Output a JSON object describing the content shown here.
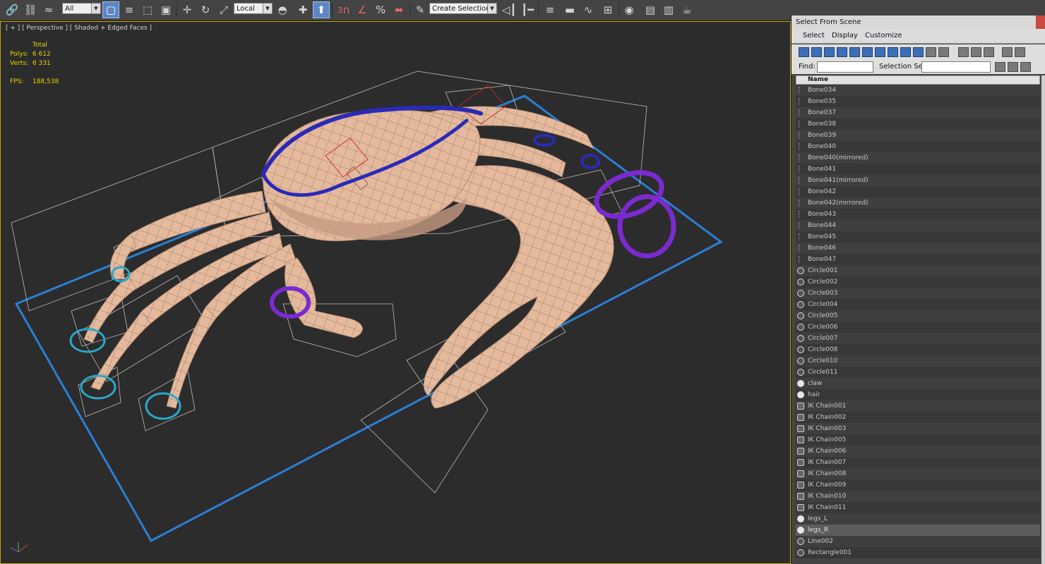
{
  "toolbar": {
    "selection_filter": "All",
    "coord_system": "Local",
    "named_selection_placeholder": "Create Selection Se",
    "snap_3d": "3",
    "percent_snap": "%"
  },
  "viewport": {
    "label": "[ + ] [ Perspective ] [ Shaded + Edged Faces ]",
    "stats": {
      "total_label": "Total",
      "polys_label": "Polys:",
      "polys_value": "6 612",
      "verts_label": "Verts:",
      "verts_value": "6 331",
      "fps_label": "FPS:",
      "fps_value": "188,538"
    }
  },
  "dialog": {
    "title": "Select From Scene",
    "menu": [
      "Select",
      "Display",
      "Customize"
    ],
    "find_label": "Find:",
    "selection_set_label": "Selection Set:",
    "column_name": "Name",
    "items": [
      {
        "name": "Bone034",
        "icon": "bone-icon"
      },
      {
        "name": "Bone035",
        "icon": "bone-icon"
      },
      {
        "name": "Bone037",
        "icon": "bone-icon"
      },
      {
        "name": "Bone038",
        "icon": "bone-icon"
      },
      {
        "name": "Bone039",
        "icon": "bone-icon"
      },
      {
        "name": "Bone040",
        "icon": "bone-icon"
      },
      {
        "name": "Bone040(mirrored)",
        "icon": "bone-icon"
      },
      {
        "name": "Bone041",
        "icon": "bone-icon"
      },
      {
        "name": "Bone041(mirrored)",
        "icon": "bone-icon"
      },
      {
        "name": "Bone042",
        "icon": "bone-icon"
      },
      {
        "name": "Bone042(mirrored)",
        "icon": "bone-icon"
      },
      {
        "name": "Bone043",
        "icon": "bone-icon"
      },
      {
        "name": "Bone044",
        "icon": "bone-icon"
      },
      {
        "name": "Bone045",
        "icon": "bone-icon"
      },
      {
        "name": "Bone046",
        "icon": "bone-icon"
      },
      {
        "name": "Bone047",
        "icon": "bone-icon"
      },
      {
        "name": "Circle001",
        "icon": "shape-icon"
      },
      {
        "name": "Circle002",
        "icon": "shape-icon"
      },
      {
        "name": "Circle003",
        "icon": "shape-icon"
      },
      {
        "name": "Circle004",
        "icon": "shape-icon"
      },
      {
        "name": "Circle005",
        "icon": "shape-icon"
      },
      {
        "name": "Circle006",
        "icon": "shape-icon"
      },
      {
        "name": "Circle007",
        "icon": "shape-icon"
      },
      {
        "name": "Circle008",
        "icon": "shape-icon"
      },
      {
        "name": "Circle010",
        "icon": "shape-icon"
      },
      {
        "name": "Circle011",
        "icon": "shape-icon"
      },
      {
        "name": "claw",
        "icon": "geometry-icon"
      },
      {
        "name": "hair",
        "icon": "geometry-icon"
      },
      {
        "name": "IK Chain001",
        "icon": "ik-chain-icon"
      },
      {
        "name": "IK Chain002",
        "icon": "ik-chain-icon"
      },
      {
        "name": "IK Chain003",
        "icon": "ik-chain-icon"
      },
      {
        "name": "IK Chain005",
        "icon": "ik-chain-icon"
      },
      {
        "name": "IK Chain006",
        "icon": "ik-chain-icon"
      },
      {
        "name": "IK Chain007",
        "icon": "ik-chain-icon"
      },
      {
        "name": "IK Chain008",
        "icon": "ik-chain-icon"
      },
      {
        "name": "IK Chain009",
        "icon": "ik-chain-icon"
      },
      {
        "name": "IK Chain010",
        "icon": "ik-chain-icon"
      },
      {
        "name": "IK Chain011",
        "icon": "ik-chain-icon"
      },
      {
        "name": "legs_L",
        "icon": "geometry-icon"
      },
      {
        "name": "legs_R",
        "icon": "geometry-icon",
        "selected": true
      },
      {
        "name": "Line002",
        "icon": "shape-icon"
      },
      {
        "name": "Rectangle001",
        "icon": "shape-icon"
      }
    ]
  },
  "colors": {
    "viewport_bg": "#2c2c2c",
    "active_viewport_border": "#c9a600",
    "stats_text": "#e8d300",
    "mesh_skin": "#e4b99c",
    "rectangle_control": "#2b7fd6",
    "carapace_control": "#2a2ab8",
    "claw_control": "#7a2ad0",
    "leg_circle_control": "#2aa8c8",
    "toolbar_bg": "#444444",
    "active_button": "#5f86c4"
  }
}
